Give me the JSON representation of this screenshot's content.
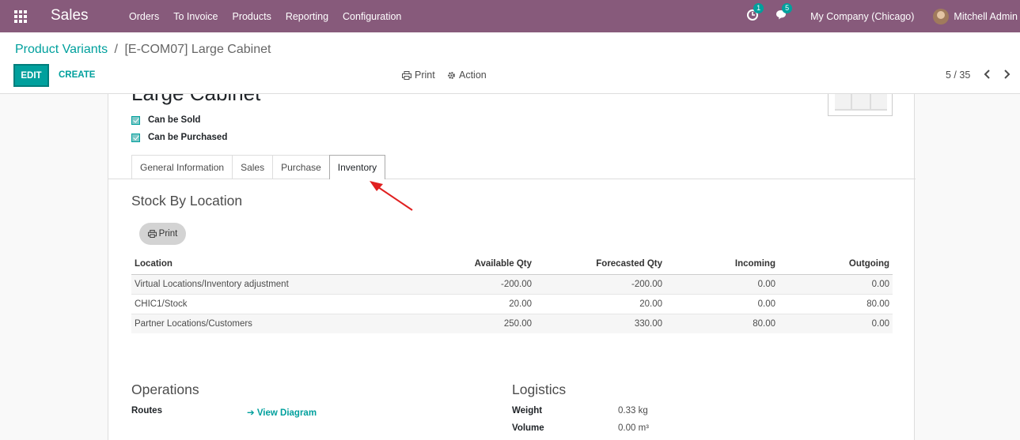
{
  "navbar": {
    "app_name": "Sales",
    "menu": [
      "Orders",
      "To Invoice",
      "Products",
      "Reporting",
      "Configuration"
    ],
    "activity_count": "1",
    "messages_count": "5",
    "company": "My Company (Chicago)",
    "user": "Mitchell Admin"
  },
  "control_panel": {
    "breadcrumb_parent": "Product Variants",
    "breadcrumb_separator": "/",
    "breadcrumb_current": "[E-COM07] Large Cabinet",
    "edit_label": "EDIT",
    "create_label": "CREATE",
    "print_label": "Print",
    "action_label": "Action",
    "pager": "5 / 35"
  },
  "form": {
    "product_name": "Large Cabinet",
    "can_be_sold": "Can be Sold",
    "can_be_purchased": "Can be Purchased",
    "tabs": [
      "General Information",
      "Sales",
      "Purchase",
      "Inventory"
    ],
    "active_tab": "Inventory",
    "stock_title": "Stock By Location",
    "print_button": "Print",
    "stock_table": {
      "headers": [
        "Location",
        "Available Qty",
        "Forecasted Qty",
        "Incoming",
        "Outgoing"
      ],
      "rows": [
        [
          "Virtual Locations/Inventory adjustment",
          "-200.00",
          "-200.00",
          "0.00",
          "0.00"
        ],
        [
          "CHIC1/Stock",
          "20.00",
          "20.00",
          "0.00",
          "80.00"
        ],
        [
          "Partner Locations/Customers",
          "250.00",
          "330.00",
          "80.00",
          "0.00"
        ]
      ]
    },
    "operations_title": "Operations",
    "routes_label": "Routes",
    "view_diagram": "View Diagram",
    "logistics_title": "Logistics",
    "weight_label": "Weight",
    "weight_value": "0.33 kg",
    "volume_label": "Volume",
    "volume_value": "0.00 m³"
  },
  "colors": {
    "navbar": "#875a7b",
    "accent": "#00a09d",
    "annotation_arrow": "#e02020"
  }
}
